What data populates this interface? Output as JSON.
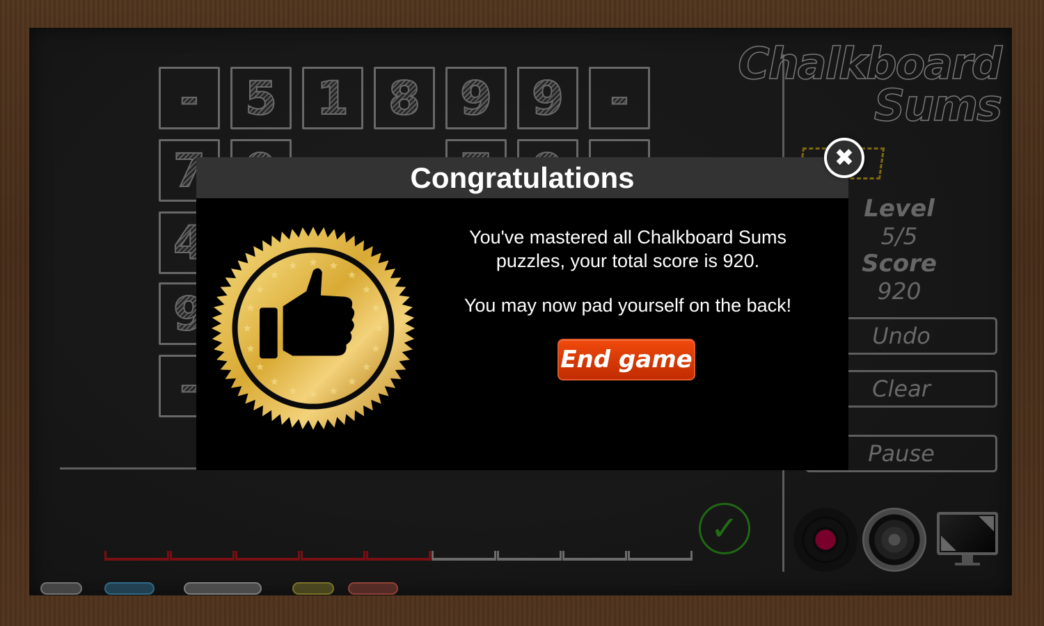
{
  "game": {
    "title_line1": "Chalkboard",
    "title_line2": "Sums"
  },
  "grid": {
    "row1": [
      "-",
      "5",
      "1",
      "8",
      "9",
      "9",
      "-"
    ],
    "row2": [
      "7",
      "9",
      "",
      "",
      "7",
      "9",
      ""
    ],
    "col1": [
      "4",
      "9",
      "-"
    ]
  },
  "stats": {
    "level_label": "Level",
    "level_value": "5/5",
    "score_label": "Score",
    "score_value": "920"
  },
  "controls": {
    "undo": "Undo",
    "clear": "Clear",
    "pause": "Pause",
    "check_glyph": "✓"
  },
  "progress": {
    "completed_segments": 5,
    "total_segments": 9,
    "done_color": "#a0141a",
    "todo_color": "#8f8f8f"
  },
  "chalks": [
    {
      "color": "#9a9a9a"
    },
    {
      "color": "#3f8fb8"
    },
    {
      "color": "#a8a8a8"
    },
    {
      "color": "#a39a3a"
    },
    {
      "color": "#c0594a"
    }
  ],
  "icons": {
    "music": "record-icon",
    "sound": "speaker-icon",
    "fullscreen": "monitor-icon"
  },
  "modal": {
    "title": "Congratulations",
    "message_line1": "You've mastered all Chalkboard Sums puzzles, your total score is 920.",
    "message_line2": "You may now pad yourself on the back!",
    "end_button": "End game",
    "close_glyph": "✖",
    "accent": "#e03a06",
    "medal_gold": "#d9aa34"
  }
}
